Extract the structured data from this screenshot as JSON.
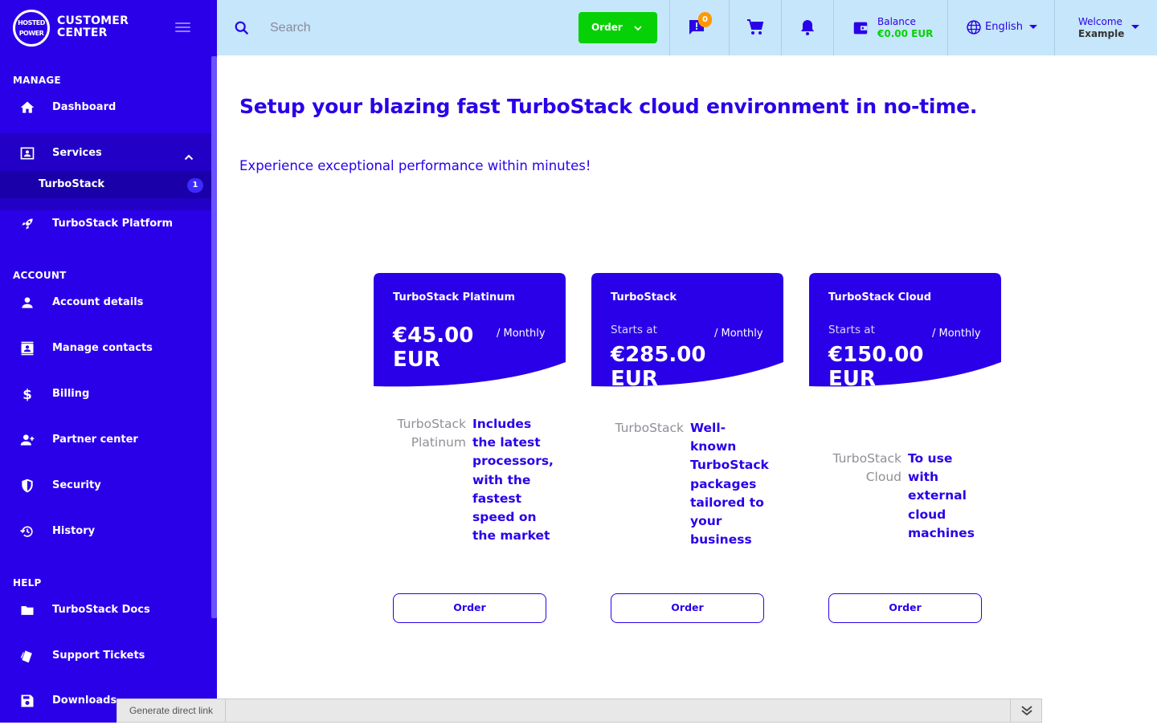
{
  "brand": {
    "logo_text": "HOSTED POWER",
    "name": "CUSTOMER CENTER"
  },
  "sidebar": {
    "sections": [
      {
        "title": "MANAGE"
      },
      {
        "title": "ACCOUNT"
      },
      {
        "title": "HELP"
      }
    ],
    "items": {
      "dashboard": "Dashboard",
      "services": "Services",
      "turbostack": "TurboStack",
      "turbostack_badge": "1",
      "turbostack_platform": "TurboStack Platform",
      "account_details": "Account details",
      "manage_contacts": "Manage contacts",
      "billing": "Billing",
      "partner_center": "Partner center",
      "security": "Security",
      "history": "History",
      "turbostack_docs": "TurboStack Docs",
      "support_tickets": "Support Tickets",
      "downloads": "Downloads"
    }
  },
  "topbar": {
    "search_placeholder": "Search",
    "order_label": "Order",
    "notifications_count": "0",
    "balance_label": "Balance",
    "balance_value": "€0.00 EUR",
    "language": "English",
    "welcome_label": "Welcome",
    "user_name": "Example"
  },
  "main": {
    "headline": "Setup your blazing fast TurboStack cloud environment in no-time.",
    "subline": "Experience exceptional performance within minutes!",
    "cards": [
      {
        "name": "TurboStack Platinum",
        "starts_at": "",
        "period": "/ Monthly",
        "price_line1": "€45.00",
        "price_line2": "EUR",
        "desc_label": [
          "TurboStack",
          "Platinum"
        ],
        "desc_text": [
          "Includes",
          "the latest",
          "processors,",
          "with the",
          "fastest",
          "speed on",
          "the market"
        ],
        "order_label": "Order"
      },
      {
        "name": "TurboStack",
        "starts_at": "Starts at",
        "period": "/ Monthly",
        "price_line1": "€285.00",
        "price_line2": "EUR",
        "desc_label": [
          "TurboStack"
        ],
        "desc_text": [
          "Well-",
          "known",
          "TurboStack",
          "packages",
          "tailored to",
          "your",
          "business"
        ],
        "order_label": "Order"
      },
      {
        "name": "TurboStack Cloud",
        "starts_at": "Starts at",
        "period": "/ Monthly",
        "price_line1": "€150.00",
        "price_line2": "EUR",
        "desc_label": [
          "TurboStack",
          "Cloud"
        ],
        "desc_text": [
          "To use",
          "with",
          "external",
          "cloud",
          "machines"
        ],
        "order_label": "Order"
      }
    ]
  },
  "debug_bar": {
    "link_label": "Generate direct link"
  },
  "colors": {
    "primary": "#2a00e8",
    "topbar": "#c6e6fb",
    "accent_green": "#06d106",
    "badge_orange": "#ff9800"
  }
}
